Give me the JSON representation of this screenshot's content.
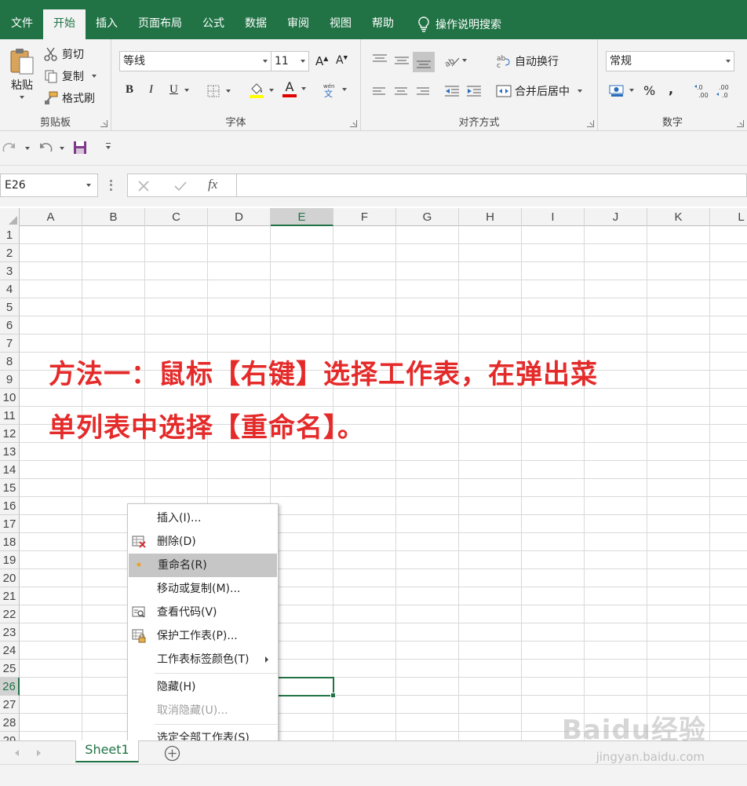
{
  "ribbon_tabs": {
    "file": "文件",
    "home": "开始",
    "insert": "插入",
    "page_layout": "页面布局",
    "formulas": "公式",
    "data": "数据",
    "review": "审阅",
    "view": "视图",
    "help": "帮助",
    "tell_me": "操作说明搜索"
  },
  "clipboard": {
    "paste": "粘贴",
    "cut": "剪切",
    "copy": "复制",
    "format_painter": "格式刷",
    "label": "剪贴板"
  },
  "font": {
    "font_name": "等线",
    "font_size": "11",
    "bold": "B",
    "italic": "I",
    "underline": "U",
    "font_color_letter": "A",
    "label": "字体"
  },
  "alignment": {
    "wrap_text": "自动换行",
    "merge_center": "合并后居中",
    "label": "对齐方式"
  },
  "number": {
    "format": "常规",
    "percent": "%",
    "comma": ",",
    "label": "数字"
  },
  "formula_bar": {
    "name_box": "E26",
    "fx": "fx",
    "content": ""
  },
  "grid": {
    "columns": [
      "A",
      "B",
      "C",
      "D",
      "E",
      "F",
      "G",
      "H",
      "I",
      "J",
      "K",
      "L"
    ],
    "rows": [
      "1",
      "2",
      "3",
      "4",
      "5",
      "6",
      "7",
      "8",
      "9",
      "10",
      "11",
      "12",
      "13",
      "14",
      "15",
      "16",
      "17",
      "18",
      "19",
      "20",
      "21",
      "22",
      "23",
      "24",
      "25",
      "26",
      "27",
      "28",
      "29"
    ],
    "selected_column": "E",
    "selected_row": "26"
  },
  "annotation": {
    "line1": "方法一：鼠标【右键】选择工作表，在弹出菜",
    "line2": "单列表中选择【重命名】。"
  },
  "context_menu": {
    "items": [
      {
        "label": "插入(I)...",
        "icon": null
      },
      {
        "label": "删除(D)",
        "icon": "delete-sheet-icon"
      },
      {
        "label": "重命名(R)",
        "icon": "bullet-dot-icon"
      },
      {
        "label": "移动或复制(M)...",
        "icon": null
      },
      {
        "label": "查看代码(V)",
        "icon": "view-code-icon"
      },
      {
        "label": "保护工作表(P)...",
        "icon": "protect-sheet-icon"
      },
      {
        "label": "工作表标签颜色(T)",
        "icon": null
      },
      {
        "label": "隐藏(H)",
        "icon": null
      },
      {
        "label": "取消隐藏(U)...",
        "icon": null
      },
      {
        "label": "选定全部工作表(S)",
        "icon": null
      }
    ]
  },
  "sheets": {
    "active": "Sheet1"
  },
  "watermark": {
    "brand": "Baidu经验",
    "url": "jingyan.baidu.com"
  },
  "colors": {
    "excel_green": "#217346",
    "annotation_red": "#e52a2a",
    "menu_highlight": "#c6c6c6"
  }
}
